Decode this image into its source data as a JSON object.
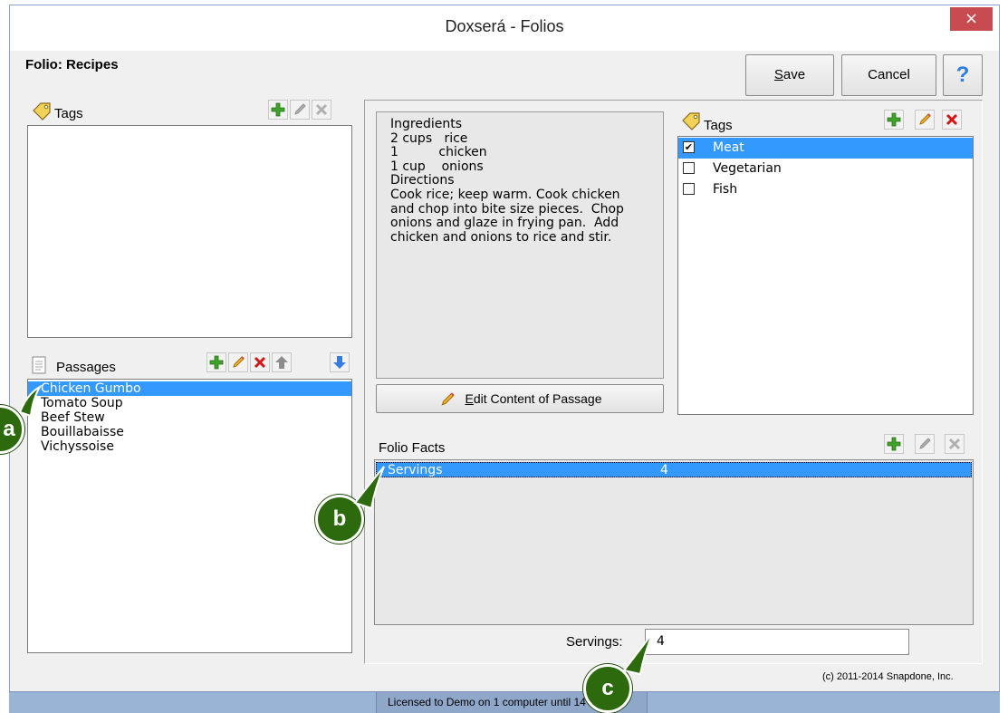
{
  "window": {
    "title": "Doxserá - Folios",
    "close_glyph": "×"
  },
  "folio": {
    "label": "Folio:",
    "name": "Recipes"
  },
  "buttons": {
    "save_underlined": "S",
    "save_rest": "ave",
    "cancel": "Cancel",
    "help": "?"
  },
  "folio_tags": {
    "label": "Tags",
    "items": []
  },
  "passages": {
    "label": "Passages",
    "items": [
      {
        "label": "Chicken Gumbo",
        "selected": true
      },
      {
        "label": "Tomato Soup",
        "selected": false
      },
      {
        "label": "Beef Stew",
        "selected": false
      },
      {
        "label": "Bouillabaisse",
        "selected": false
      },
      {
        "label": "Vichyssoise",
        "selected": false
      }
    ]
  },
  "passage_content": {
    "lines": [
      "Ingredients",
      "2 cups   rice",
      "1          chicken",
      "1 cup    onions",
      "Directions",
      "Cook rice; keep warm. Cook chicken",
      "and chop into bite size pieces.  Chop",
      "onions and glaze in frying pan.  Add",
      "chicken and onions to rice and stir."
    ],
    "edit_button_underlined": "E",
    "edit_button_rest": "dit Content of Passage"
  },
  "passage_tags": {
    "label": "Tags",
    "items": [
      {
        "label": "Meat",
        "checked": true,
        "selected": true
      },
      {
        "label": "Vegetarian",
        "checked": false,
        "selected": false
      },
      {
        "label": "Fish",
        "checked": false,
        "selected": false
      }
    ]
  },
  "folio_facts": {
    "label": "Folio Facts",
    "rows": [
      {
        "name": "Servings",
        "value": "4",
        "selected": true
      }
    ]
  },
  "servings_field": {
    "label": "Servings:",
    "value": "4"
  },
  "copyright": "(c) 2011-2014 Snapdone, Inc.",
  "status": "Licensed to Demo on 1 computer until 14",
  "callouts": {
    "a": "a",
    "b": "b",
    "c": "c"
  },
  "colors": {
    "selection": "#3399ff",
    "callout": "#2d6a0d",
    "add": "#3fa22a",
    "delete": "#d21919",
    "arrow_up": "#8c8c8c",
    "arrow_down": "#3a7be0"
  },
  "icons": [
    "tag-icon",
    "add-icon",
    "edit-icon",
    "delete-icon",
    "move-up-icon",
    "move-down-icon",
    "passage-icon",
    "pencil-icon",
    "help-icon",
    "close-icon"
  ]
}
